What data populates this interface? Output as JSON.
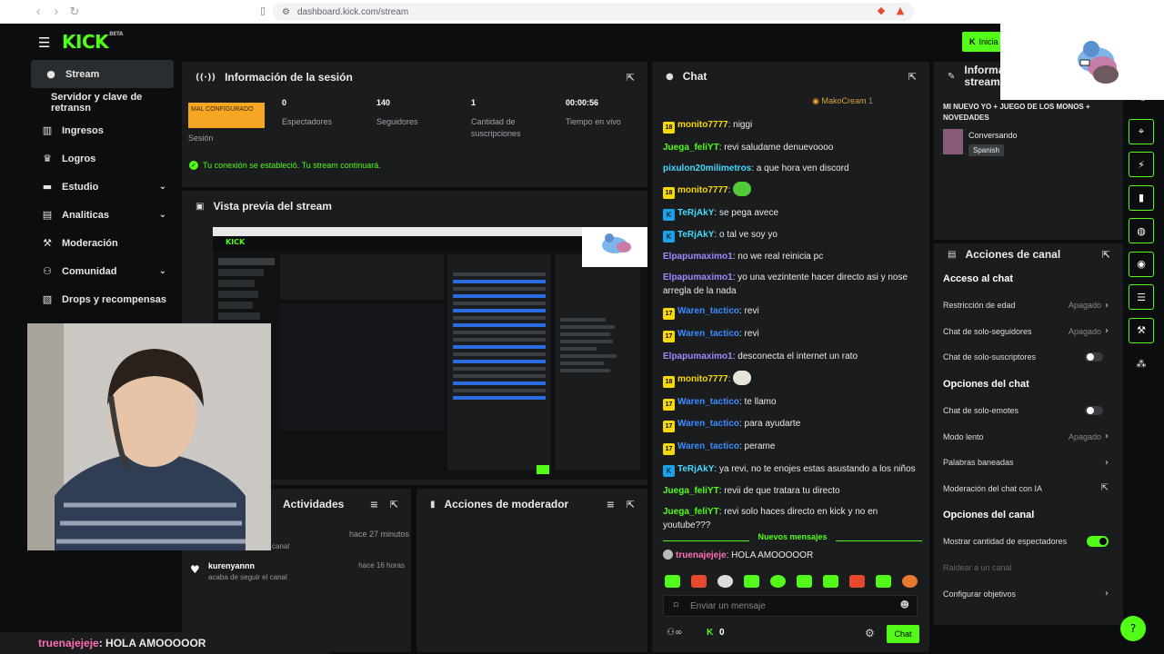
{
  "browser": {
    "url": "dashboard.kick.com/stream",
    "back_icon": "arrow-left-icon",
    "forward_icon": "arrow-right-icon",
    "reload_icon": "reload-icon"
  },
  "topnav": {
    "logo": "KICK",
    "logo_badge": "BETA",
    "golive_label": "Inicia"
  },
  "sidebar": {
    "items": [
      {
        "label": "Stream",
        "icon": "camera-icon",
        "active": true
      },
      {
        "label": "Servidor y clave de retransn",
        "icon": "",
        "sub": true
      },
      {
        "label": "Ingresos",
        "icon": "chart-icon"
      },
      {
        "label": "Logros",
        "icon": "trophy-icon"
      },
      {
        "label": "Estudio",
        "icon": "studio-icon",
        "chevron": true
      },
      {
        "label": "Analiticas",
        "icon": "analytics-icon",
        "chevron": true
      },
      {
        "label": "Moderación",
        "icon": "wrench-icon"
      },
      {
        "label": "Comunidad",
        "icon": "community-icon",
        "chevron": true
      },
      {
        "label": "Drops y recompensas",
        "icon": "gift-icon"
      }
    ]
  },
  "session": {
    "title": "Información de la sesión",
    "status_badge": "MAL CONFIGURADO",
    "status_label": "Sesión",
    "stats": [
      {
        "value": "0",
        "label": "Espectadores"
      },
      {
        "value": "140",
        "label": "Seguidores"
      },
      {
        "value": "1",
        "label": "Cantidad de suscripciones"
      },
      {
        "value": "00:00:56",
        "label": "Tiempo en vivo"
      }
    ],
    "connection_msg": "Tu conexión se estableció. Tu stream continuará."
  },
  "preview": {
    "title": "Vista previa del stream"
  },
  "activity": {
    "title": "Actividades",
    "items": [
      {
        "name": "",
        "detail": "canal",
        "time": "hace 27 minutos"
      },
      {
        "name": "kurenyannn",
        "detail": "acaba de seguir el canal",
        "time": "hace 16 horas"
      }
    ]
  },
  "modactions": {
    "title": "Acciones de moderador"
  },
  "chat": {
    "title": "Chat",
    "pinned_user": "MakoCream",
    "pinned_count": "1",
    "messages": [
      {
        "badge": "18",
        "badge_type": "lvl",
        "user": "monito7777",
        "color": "#f5d90a",
        "text": "niggi"
      },
      {
        "badge": "",
        "badge_type": "",
        "user": "Juega_feliYT",
        "color": "#53fc18",
        "text": "revi saludame denuevoooo"
      },
      {
        "badge": "",
        "badge_type": "",
        "user": "pixulon20milimetros",
        "color": "#43d9ff",
        "text": "a que hora ven discord"
      },
      {
        "badge": "18",
        "badge_type": "lvl",
        "user": "monito7777",
        "color": "#f5d90a",
        "text": "",
        "emote": "#53c93a"
      },
      {
        "badge": "K",
        "badge_type": "kk",
        "user": "TeRjAkY",
        "color": "#43d9ff",
        "text": "se pega avece"
      },
      {
        "badge": "K",
        "badge_type": "kk",
        "user": "TeRjAkY",
        "color": "#43d9ff",
        "text": "o tal ve soy yo"
      },
      {
        "badge": "",
        "badge_type": "",
        "user": "Elpapumaximo1",
        "color": "#9b8cff",
        "text": "no we real reinicia pc"
      },
      {
        "badge": "",
        "badge_type": "",
        "user": "Elpapumaximo1",
        "color": "#9b8cff",
        "text": "yo una vezintente hacer directo asi y nose arregla de la nada"
      },
      {
        "badge": "17",
        "badge_type": "lvl",
        "user": "Waren_tactico",
        "color": "#3b8cff",
        "text": "revi"
      },
      {
        "badge": "17",
        "badge_type": "lvl",
        "user": "Waren_tactico",
        "color": "#3b8cff",
        "text": "revi"
      },
      {
        "badge": "",
        "badge_type": "",
        "user": "Elpapumaximo1",
        "color": "#9b8cff",
        "text": "desconecta el internet un rato"
      },
      {
        "badge": "18",
        "badge_type": "lvl",
        "user": "monito7777",
        "color": "#f5d90a",
        "text": "",
        "emote": "#e8e4d8"
      },
      {
        "badge": "17",
        "badge_type": "lvl",
        "user": "Waren_tactico",
        "color": "#3b8cff",
        "text": "te llamo"
      },
      {
        "badge": "17",
        "badge_type": "lvl",
        "user": "Waren_tactico",
        "color": "#3b8cff",
        "text": "para ayudarte"
      },
      {
        "badge": "17",
        "badge_type": "lvl",
        "user": "Waren_tactico",
        "color": "#3b8cff",
        "text": "perame"
      },
      {
        "badge": "K",
        "badge_type": "kk",
        "user": "TeRjAkY",
        "color": "#43d9ff",
        "text": "ya revi, no te enojes estas asustando a los niños"
      },
      {
        "badge": "",
        "badge_type": "",
        "user": "Juega_feliYT",
        "color": "#53fc18",
        "text": "revii de que tratara tu directo"
      },
      {
        "badge": "",
        "badge_type": "",
        "user": "Juega_feliYT",
        "color": "#53fc18",
        "text": "revi solo haces directo en kick y no en youtube???"
      }
    ],
    "new_messages": "Nuevos mensajes",
    "reply_user": "truenajejeje",
    "reply_text": "HOLA AMOOOOOR",
    "input_placeholder": "Enviar un mensaje",
    "footer_count": "0",
    "send_label": "Chat"
  },
  "streaminfo": {
    "title": "Informa stream",
    "stream_title": "MI NUEVO YO + JUEGO DE LOS MONOS + NOVEDADES",
    "category": "Conversando",
    "language": "Spanish"
  },
  "channel_actions": {
    "title": "Acciones de canal",
    "sections": [
      {
        "heading": "Acceso al chat",
        "items": [
          {
            "label": "Restricción de edad",
            "value": "Apagado",
            "kind": "chevron"
          },
          {
            "label": "Chat de solo-seguidores",
            "value": "Apagado",
            "kind": "chevron"
          },
          {
            "label": "Chat de solo-suscriptores",
            "value": "",
            "kind": "toggle-off"
          }
        ]
      },
      {
        "heading": "Opciones del chat",
        "items": [
          {
            "label": "Chat de solo-emotes",
            "value": "",
            "kind": "toggle-off"
          },
          {
            "label": "Modo lento",
            "value": "Apagado",
            "kind": "chevron"
          },
          {
            "label": "Palabras baneadas",
            "value": "",
            "kind": "chevron"
          },
          {
            "label": "Moderación del chat con IA",
            "value": "",
            "kind": "external"
          }
        ]
      },
      {
        "heading": "Opciones del canal",
        "items": [
          {
            "label": "Mostrar cantidad de espectadores",
            "value": "",
            "kind": "toggle-on"
          },
          {
            "label": "Raidear a un canal",
            "value": "",
            "kind": "disabled"
          },
          {
            "label": "Configurar objetivos",
            "value": "",
            "kind": "chevron"
          }
        ]
      }
    ]
  },
  "caption": {
    "user": "truenajejeje",
    "text": " : HOLA AMOOOOOR"
  },
  "colors": {
    "accent": "#53fc18",
    "panel": "#1a1c1e",
    "warn": "#f5a623",
    "background": "#0b0d0e"
  }
}
